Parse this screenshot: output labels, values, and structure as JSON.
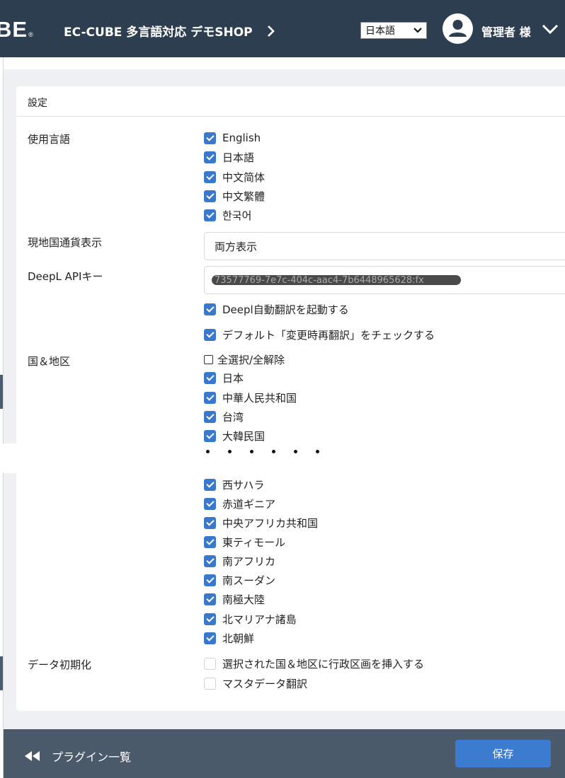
{
  "header": {
    "logo_text": "BE",
    "logo_mark": "®",
    "shop_name": "EC-CUBE 多言語対応 デモSHOP",
    "language_selected": "日本語",
    "user_name": "管理者 様"
  },
  "card": {
    "title": "設定"
  },
  "languages": {
    "label": "使用言語",
    "items": [
      {
        "label": "English",
        "checked": true
      },
      {
        "label": "日本語",
        "checked": true
      },
      {
        "label": "中文简体",
        "checked": true
      },
      {
        "label": "中文繁體",
        "checked": true
      },
      {
        "label": "한국어",
        "checked": true
      }
    ]
  },
  "currency": {
    "label": "現地国通貨表示",
    "value": "両方表示"
  },
  "deepl": {
    "label": "DeepL APIキー",
    "api_key": "73577769-7e7c-404c-aac4-7b6448965628:fx",
    "auto_translate_label": "Deepl自動翻訳を起動する",
    "default_check_label": "デフォルト「変更時再翻訳」をチェックする"
  },
  "regions": {
    "label": "国＆地区",
    "select_all_label": "全選択/全解除",
    "items_top": [
      "日本",
      "中華人民共和国",
      "台湾",
      "大韓民国"
    ],
    "items_bottom": [
      "西サハラ",
      "赤道ギニア",
      "中央アフリカ共和国",
      "東ティモール",
      "南アフリカ",
      "南スーダン",
      "南極大陸",
      "北マリアナ諸島",
      "北朝鮮"
    ]
  },
  "data_init": {
    "label": "データ初期化",
    "options": [
      {
        "label": "選択された国＆地区に行政区画を挿入する",
        "checked": false
      },
      {
        "label": "マスタデータ翻訳",
        "checked": false
      }
    ]
  },
  "footer": {
    "back_label": "プラグイン一覧",
    "save_label": "保存"
  },
  "colors": {
    "header_bg": "#2c3e50",
    "footer_bg": "#4b5a6a",
    "accent": "#3a78cc"
  }
}
